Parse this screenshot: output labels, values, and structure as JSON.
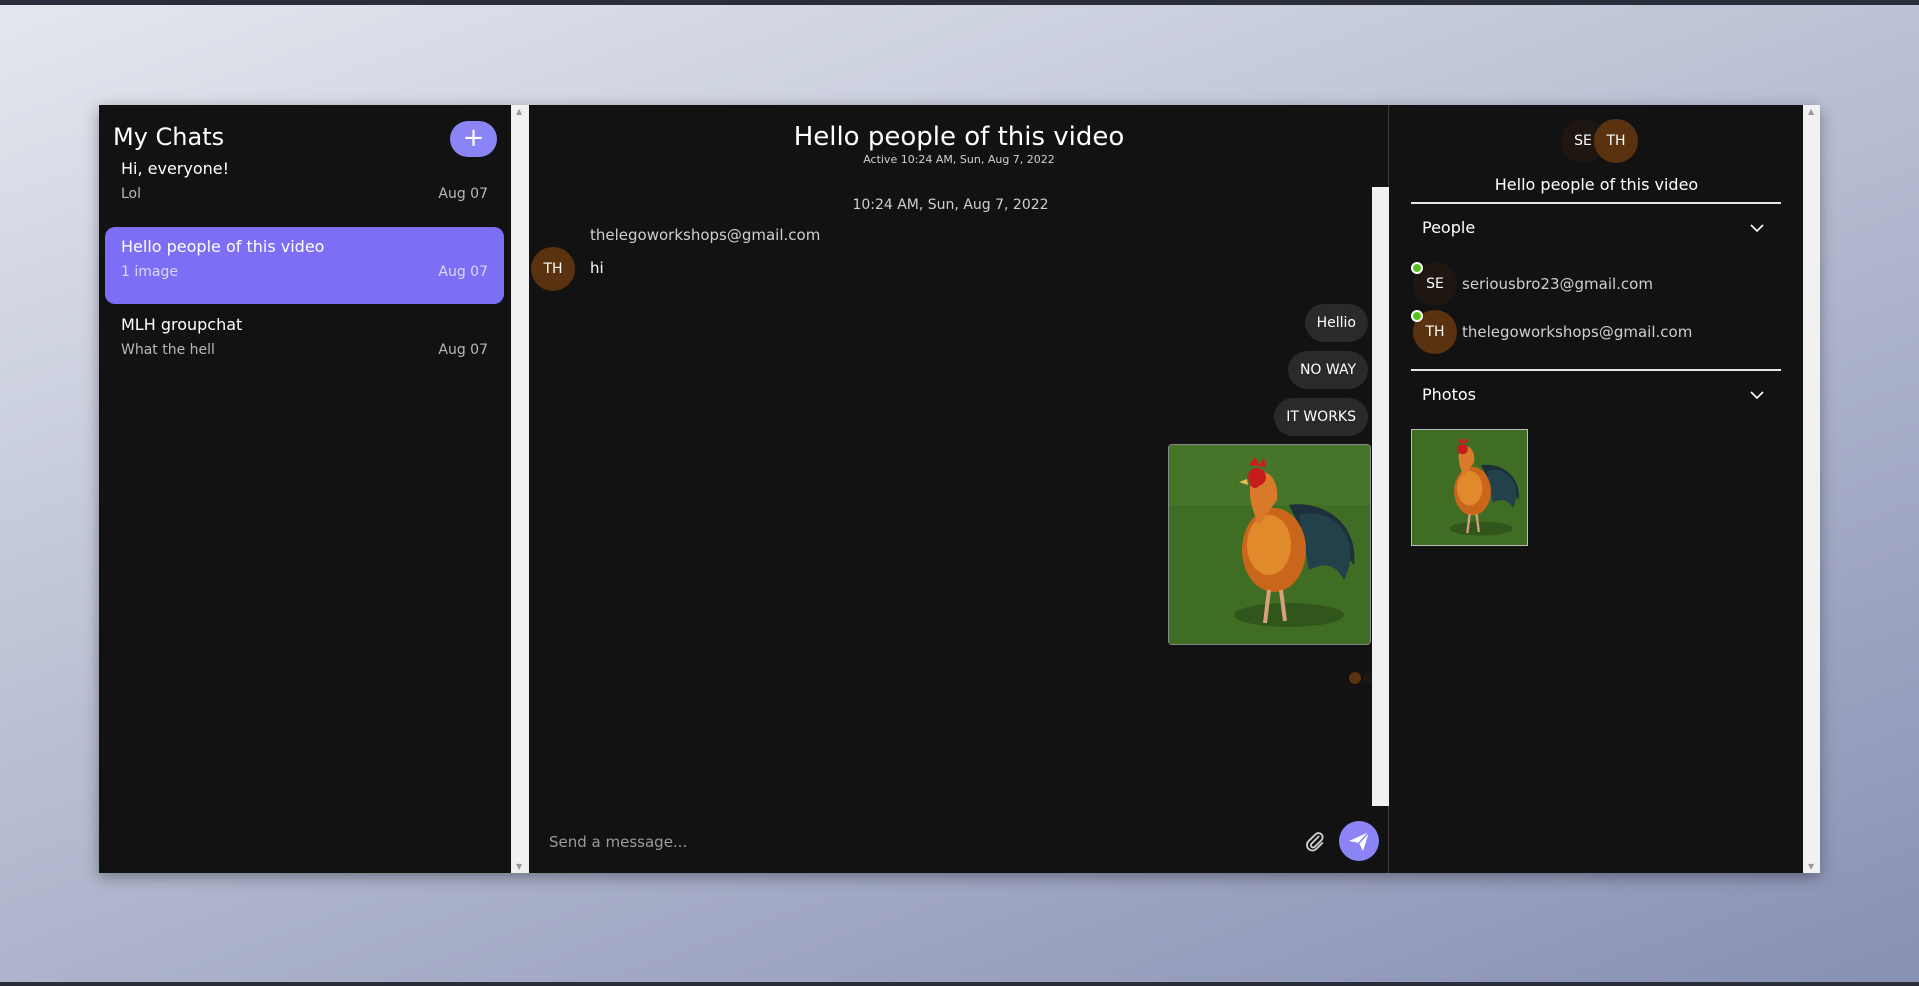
{
  "chat_list": {
    "title": "My Chats",
    "new_button": "+",
    "chats": [
      {
        "name": "Hi, everyone!",
        "preview": "Lol",
        "date": "Aug 07",
        "active": false
      },
      {
        "name": "Hello people of this video",
        "preview": "1 image",
        "date": "Aug 07",
        "active": true
      },
      {
        "name": "MLH groupchat",
        "preview": "What the hell",
        "date": "Aug 07",
        "active": false
      }
    ]
  },
  "feed": {
    "title": "Hello people of this video",
    "subtitle": "Active 10:24 AM, Sun, Aug 7, 2022",
    "timestamp": "10:24 AM, Sun, Aug 7, 2022",
    "incoming": {
      "sender": "thelegoworkshops@gmail.com",
      "avatar": "TH",
      "text": "hi"
    },
    "outgoing": [
      "Hellio",
      "NO WAY",
      "IT WORKS"
    ],
    "image_message": "rooster photo",
    "composer_placeholder": "Send a message..."
  },
  "settings": {
    "avatars": [
      "SE",
      "TH"
    ],
    "title": "Hello people of this video",
    "people_label": "People",
    "people": [
      {
        "initials": "SE",
        "email": "seriousbro23@gmail.com",
        "online": true
      },
      {
        "initials": "TH",
        "email": "thelegoworkshops@gmail.com",
        "online": true
      }
    ],
    "photos_label": "Photos"
  },
  "colors": {
    "accent": "#8b84f5",
    "active_chat": "#7c6ff6",
    "panel_bg": "#121212",
    "online": "#52c41a"
  },
  "icons": {
    "attach": "paperclip-icon",
    "send": "paper-plane-icon",
    "chevron": "chevron-down-icon"
  }
}
